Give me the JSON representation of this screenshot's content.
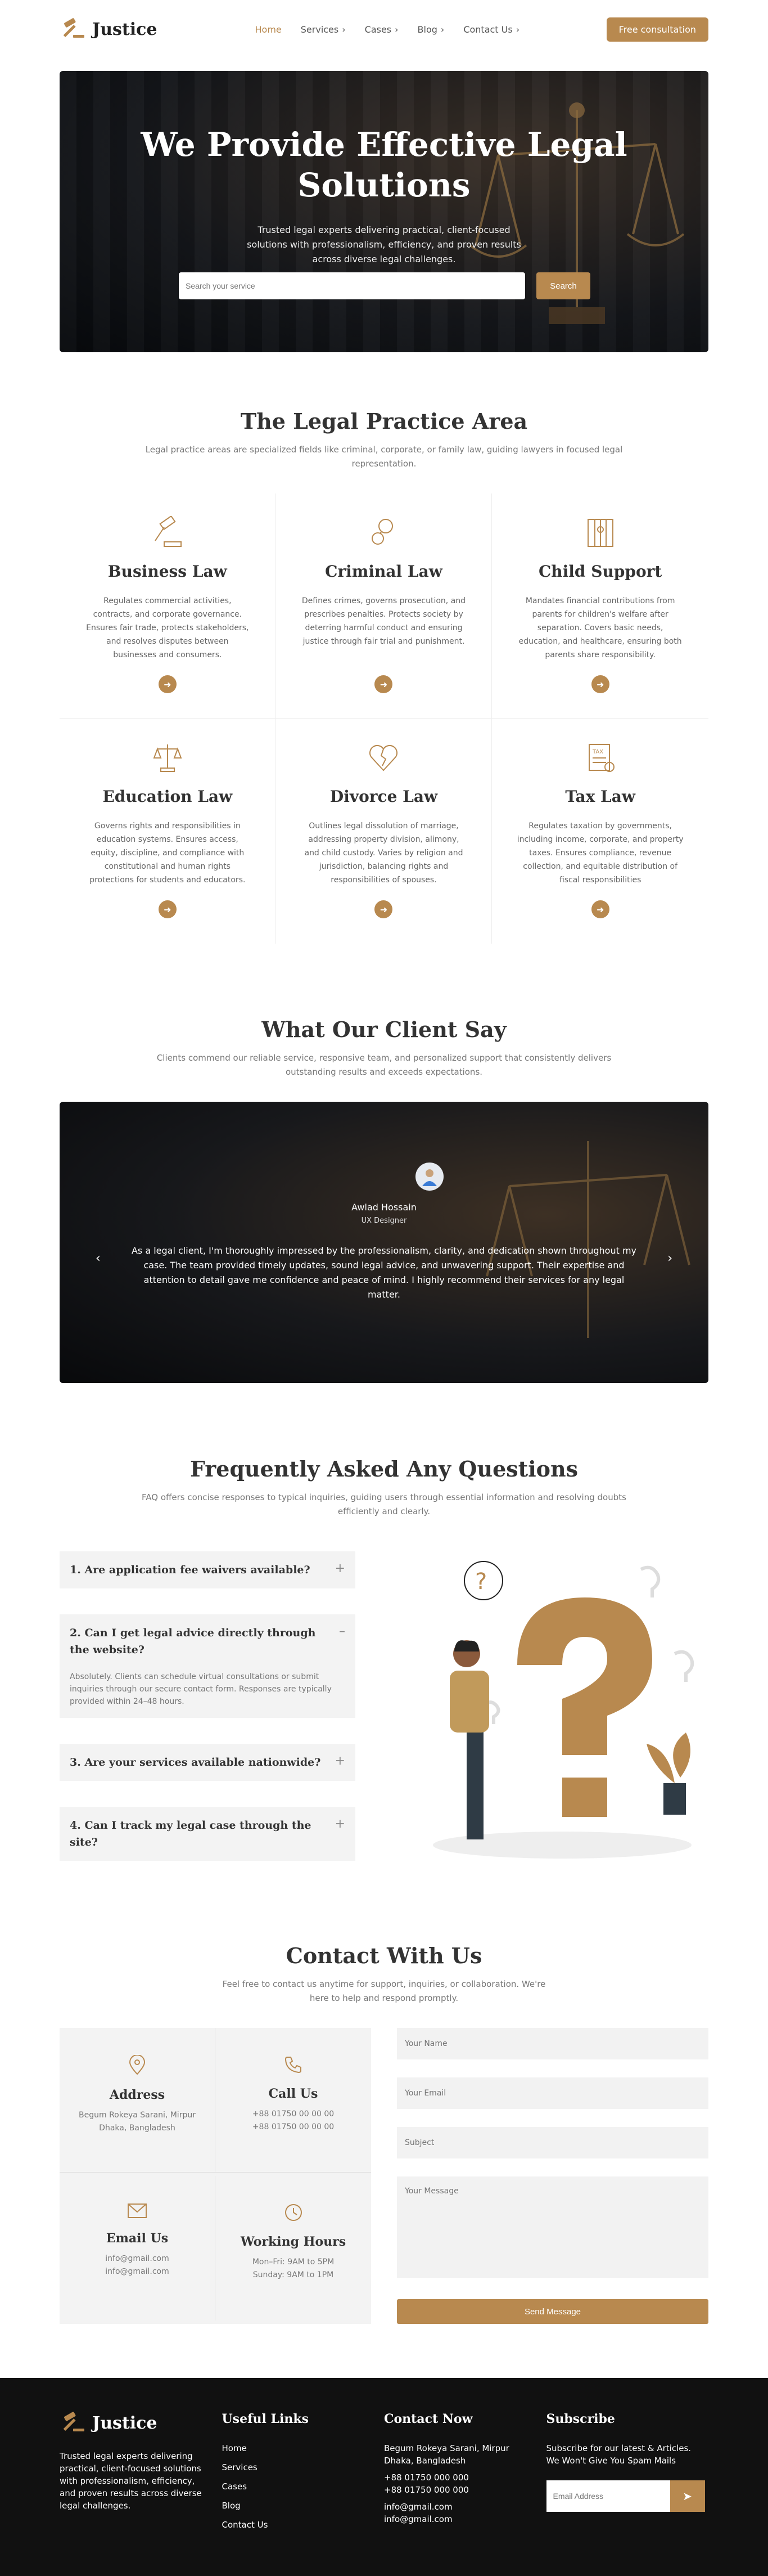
{
  "brand": {
    "name": "Justice"
  },
  "nav": {
    "items": [
      {
        "label": "Home"
      },
      {
        "label": "Services"
      },
      {
        "label": "Cases"
      },
      {
        "label": "Blog"
      },
      {
        "label": "Contact Us"
      }
    ],
    "cta": "Free consultation"
  },
  "hero": {
    "title": "We Provide Effective Legal Solutions",
    "subtitle": "Trusted legal experts delivering practical, client-focused solutions with professionalism, efficiency, and proven results across diverse legal challenges.",
    "search_placeholder": "Search your service",
    "search_button": "Search"
  },
  "practice": {
    "title": "The Legal Practice Area",
    "subtitle": "Legal practice areas are specialized fields like criminal, corporate, or family law, guiding lawyers in focused legal representation.",
    "cards": [
      {
        "title": "Business Law",
        "text": "Regulates commercial activities, contracts, and corporate governance. Ensures fair trade, protects stakeholders, and resolves disputes between businesses and consumers."
      },
      {
        "title": "Criminal Law",
        "text": "Defines crimes, governs prosecution, and prescribes penalties. Protects society by deterring harmful conduct and ensuring justice through fair trial and punishment."
      },
      {
        "title": "Child Support",
        "text": "Mandates financial contributions from parents for children's welfare after separation. Covers basic needs, education, and healthcare, ensuring both parents share responsibility."
      },
      {
        "title": "Education Law",
        "text": "Governs rights and responsibilities in education systems. Ensures access, equity, discipline, and compliance with constitutional and human rights protections for students and educators."
      },
      {
        "title": "Divorce Law",
        "text": "Outlines legal dissolution of marriage, addressing property division, alimony, and child custody. Varies by religion and jurisdiction, balancing rights and responsibilities of spouses."
      },
      {
        "title": "Tax Law",
        "text": "Regulates taxation by governments, including income, corporate, and property taxes. Ensures compliance, revenue collection, and equitable distribution of fiscal responsibilities"
      }
    ]
  },
  "testimonials": {
    "title": "What Our Client Say",
    "subtitle": "Clients commend our reliable service, responsive team, and personalized support that consistently delivers outstanding results and exceeds expectations.",
    "name": "Awlad Hossain",
    "role": "UX Designer",
    "quote": "As a legal client, I'm thoroughly impressed by the professionalism, clarity, and dedication shown throughout my case. The team provided timely updates, sound legal advice, and unwavering support. Their expertise and attention to detail gave me confidence and peace of mind. I highly recommend their services for any legal matter."
  },
  "faq": {
    "title": "Frequently Asked Any Questions",
    "subtitle": "FAQ offers concise responses to typical inquiries, guiding users through essential information and resolving doubts efficiently and clearly.",
    "items": [
      {
        "q": "1. Are application fee waivers available?",
        "toggle": "+",
        "a": ""
      },
      {
        "q": "2. Can I get legal advice directly through the website?",
        "toggle": "–",
        "a": "Absolutely. Clients can schedule virtual consultations or submit inquiries through our secure contact form. Responses are typically provided within 24–48 hours."
      },
      {
        "q": "3. Are your services available nationwide?",
        "toggle": "+",
        "a": ""
      },
      {
        "q": "4. Can I track my legal case through the site?",
        "toggle": "+",
        "a": ""
      }
    ]
  },
  "contact": {
    "title": "Contact With Us",
    "subtitle": "Feel free to contact us anytime for support, inquiries, or collaboration. We're here to help and respond promptly.",
    "info": [
      {
        "title": "Address",
        "line1": "Begum Rokeya Sarani, Mirpur",
        "line2": "Dhaka, Bangladesh"
      },
      {
        "title": "Call Us",
        "line1": "+88 01750 00 00 00",
        "line2": "+88 01750 00 00 00"
      },
      {
        "title": "Email Us",
        "line1": "info@gmail.com",
        "line2": "info@gmail.com"
      },
      {
        "title": "Working Hours",
        "line1": "Mon–Fri: 9AM to 5PM",
        "line2": "Sunday: 9AM to 1PM"
      }
    ],
    "form": {
      "name": "Your Name",
      "email": "Your Email",
      "subject": "Subject",
      "message": "Your Message",
      "submit": "Send Message"
    }
  },
  "footer": {
    "about": "Trusted legal experts delivering practical, client-focused solutions with professionalism, efficiency, and proven results across diverse legal challenges.",
    "links_title": "Useful Links",
    "links": [
      "Home",
      "Services",
      "Cases",
      "Blog",
      "Contact Us"
    ],
    "contact_title": "Contact Now",
    "contact": [
      "Begum Rokeya Sarani, Mirpur Dhaka, Bangladesh",
      "+88 01750 000 000",
      "+88 01750 000 000",
      "info@gmail.com",
      "info@gmail.com"
    ],
    "subscribe_title": "Subscribe",
    "subscribe_text": "Subscribe for our latest & Articles. We Won't Give You Spam Mails",
    "subscribe_placeholder": "Email Address"
  },
  "colors": {
    "accent": "#B8894F",
    "footer_bg": "#111111"
  }
}
